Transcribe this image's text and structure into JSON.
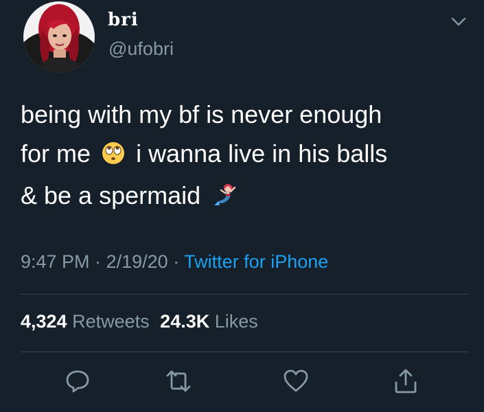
{
  "user": {
    "display_name": "bri",
    "handle": "@ufobri"
  },
  "tweet": {
    "line1": "being with my bf is never enough",
    "line2_before_emoji": "for me",
    "line2_after_emoji": "i wanna live in his balls",
    "line3": "& be a spermaid",
    "emoji_1": "eye-roll-emoji",
    "emoji_2": "mermaid-emoji"
  },
  "meta": {
    "time": "9:47 PM",
    "sep1": " · ",
    "date": "2/19/20",
    "sep2": " · ",
    "source": "Twitter for iPhone"
  },
  "stats": {
    "retweets_count": "4,324",
    "retweets_label": "Retweets",
    "likes_count": "24.3K",
    "likes_label": "Likes"
  },
  "icons": {
    "reply": "reply-icon",
    "retweet": "retweet-icon",
    "like": "heart-icon",
    "share": "share-icon",
    "more": "chevron-down-icon"
  },
  "colors": {
    "background": "#15202b",
    "text": "#ffffff",
    "secondary": "#8899a6",
    "link": "#1da1f2",
    "divider": "#38444d"
  }
}
